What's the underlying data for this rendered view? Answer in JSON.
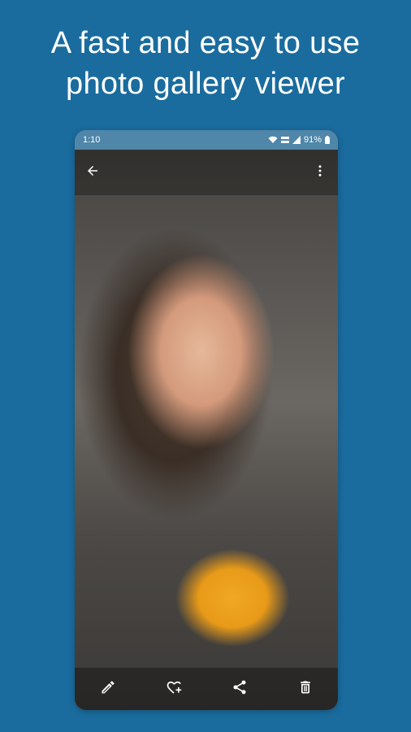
{
  "headline": {
    "line1": "A fast and easy to use",
    "line2": "photo gallery viewer"
  },
  "colors": {
    "background": "#1a6c9e",
    "status_bar": "#4f86a9",
    "icon": "#ffffff"
  },
  "status_bar": {
    "time": "1:10",
    "battery": "91%",
    "icons": [
      "wifi-icon",
      "volte-icon",
      "signal-icon",
      "battery-icon"
    ]
  },
  "top_bar": {
    "icons": [
      "arrow-back-icon",
      "more-vert-icon"
    ]
  },
  "bottom_bar": {
    "icons": [
      "edit-icon",
      "favorite-add-icon",
      "share-icon",
      "delete-icon"
    ]
  }
}
